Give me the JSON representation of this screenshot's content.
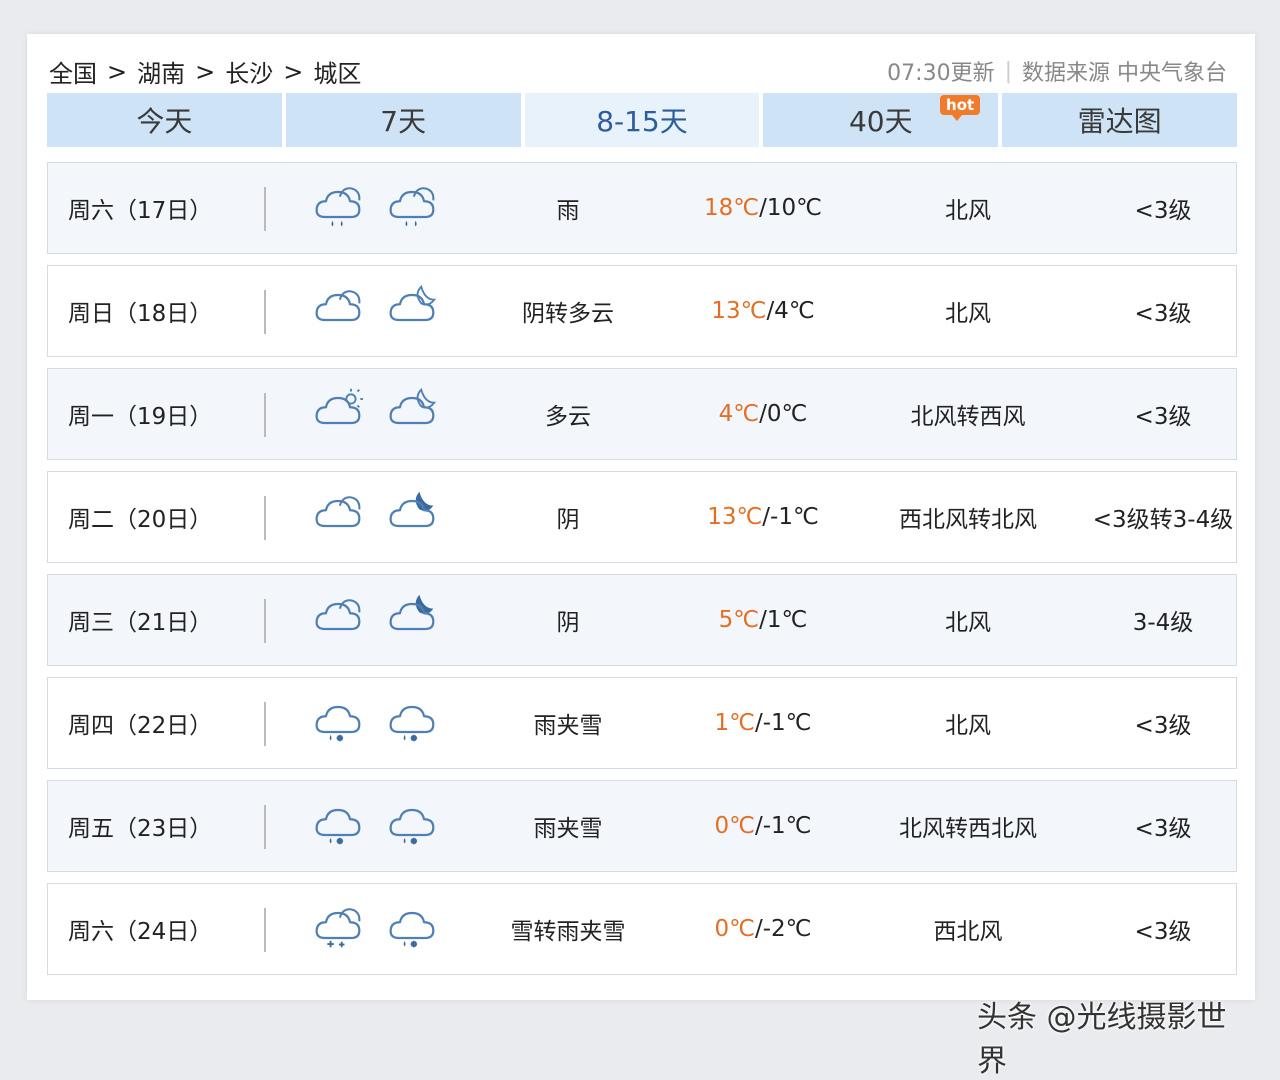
{
  "breadcrumb": [
    "全国",
    "湖南",
    "长沙",
    "城区"
  ],
  "breadcrumb_sep": ">",
  "update": {
    "time": "07:30更新",
    "source": "数据来源 中央气象台"
  },
  "tabs": [
    {
      "label": "今天",
      "active": false
    },
    {
      "label": "7天",
      "active": false
    },
    {
      "label": "8-15天",
      "active": true
    },
    {
      "label": "40天",
      "active": false,
      "badge": "hot"
    },
    {
      "label": "雷达图",
      "active": false
    }
  ],
  "rows": [
    {
      "day": "周六（17日）",
      "icons": [
        "rain-cloud-icon",
        "rain-cloud-icon"
      ],
      "weather": "雨",
      "temp_high": "18℃",
      "temp_low": "/10℃",
      "wind": "北风",
      "level": "<3级"
    },
    {
      "day": "周日（18日）",
      "icons": [
        "cloudy-icon",
        "cloudy-night-icon"
      ],
      "weather": "阴转多云",
      "temp_high": "13℃",
      "temp_low": "/4℃",
      "wind": "北风",
      "level": "<3级"
    },
    {
      "day": "周一（19日）",
      "icons": [
        "partly-cloudy-day-icon",
        "cloudy-night-icon"
      ],
      "weather": "多云",
      "temp_high": "4℃",
      "temp_low": "/0℃",
      "wind": "北风转西风",
      "level": "<3级"
    },
    {
      "day": "周二（20日）",
      "icons": [
        "cloudy-icon",
        "overcast-night-icon"
      ],
      "weather": "阴",
      "temp_high": "13℃",
      "temp_low": "/-1℃",
      "wind": "西北风转北风",
      "level": "<3级转3-4级"
    },
    {
      "day": "周三（21日）",
      "icons": [
        "cloudy-icon",
        "overcast-night-icon"
      ],
      "weather": "阴",
      "temp_high": "5℃",
      "temp_low": "/1℃",
      "wind": "北风",
      "level": "3-4级"
    },
    {
      "day": "周四（22日）",
      "icons": [
        "sleet-icon",
        "sleet-icon"
      ],
      "weather": "雨夹雪",
      "temp_high": "1℃",
      "temp_low": "/-1℃",
      "wind": "北风",
      "level": "<3级"
    },
    {
      "day": "周五（23日）",
      "icons": [
        "sleet-icon",
        "sleet-icon"
      ],
      "weather": "雨夹雪",
      "temp_high": "0℃",
      "temp_low": "/-1℃",
      "wind": "北风转西北风",
      "level": "<3级"
    },
    {
      "day": "周六（24日）",
      "icons": [
        "snow-icon",
        "sleet-icon"
      ],
      "weather": "雪转雨夹雪",
      "temp_high": "0℃",
      "temp_low": "/-2℃",
      "wind": "西北风",
      "level": "<3级"
    }
  ],
  "watermark": "头条 @光线摄影世界",
  "colors": {
    "tab_bg": "#cfe3f7",
    "tab_active_bg": "#e7f2fb",
    "tab_active_text": "#2e5d9c",
    "temp_high": "#e46e24",
    "icon_stroke": "#4f7fb3",
    "hot_badge": "#f07b2a"
  }
}
